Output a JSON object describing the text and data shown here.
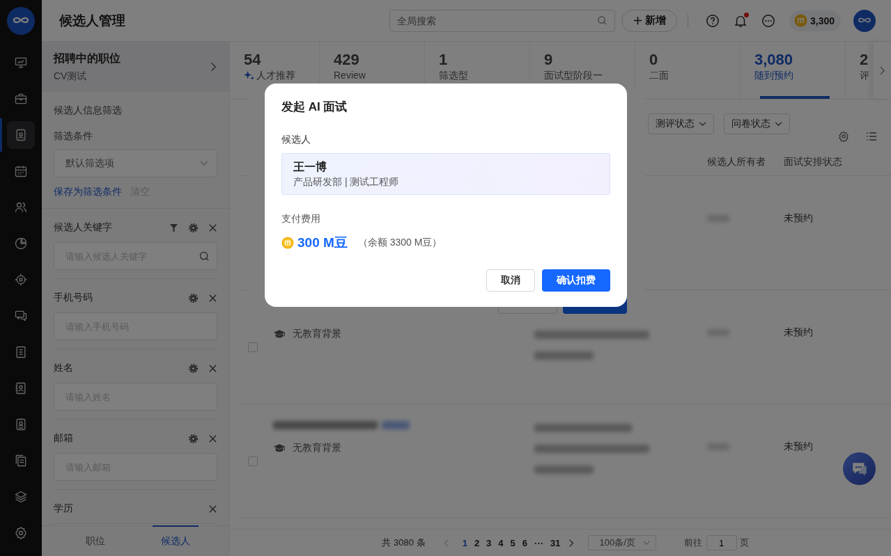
{
  "nav_rail": {
    "items": [
      {
        "selected": false
      },
      {
        "selected": false
      },
      {
        "selected": true
      },
      {
        "selected": false
      },
      {
        "selected": false
      },
      {
        "selected": false
      },
      {
        "selected": false
      },
      {
        "selected": false
      },
      {
        "selected": false
      },
      {
        "selected": false
      },
      {
        "selected": false
      },
      {
        "selected": false
      },
      {
        "selected": false
      },
      {
        "selected": false
      }
    ]
  },
  "header": {
    "title": "候选人管理",
    "search": {
      "placeholder": "全局搜索"
    },
    "add_button": "新增",
    "unread_notifications": true,
    "coins": "3,300"
  },
  "position_card": {
    "title": "招聘中的职位",
    "subtitle": "CV测试"
  },
  "filter": {
    "heading": "候选人信息筛选",
    "conditions_label": "筛选条件",
    "select_value": "默认筛选项",
    "save_link": "保存为筛选条件",
    "clear_link": "清空"
  },
  "fields": [
    {
      "label": "候选人关键字",
      "placeholder": "请输入候选人关键字",
      "filter_icon": true,
      "settings_icon": true,
      "search_icon": true
    },
    {
      "label": "手机号码",
      "placeholder": "请输入手机号码",
      "filter_icon": false,
      "settings_icon": true,
      "search_icon": false
    },
    {
      "label": "姓名",
      "placeholder": "请输入姓名",
      "filter_icon": false,
      "settings_icon": true,
      "search_icon": false
    },
    {
      "label": "邮箱",
      "placeholder": "请输入邮箱",
      "filter_icon": false,
      "settings_icon": true,
      "search_icon": false
    },
    {
      "label": "学历",
      "filter_icon": false,
      "settings_icon": false,
      "search_icon": false
    }
  ],
  "panel_tabs": [
    {
      "label": "职位",
      "selected": false
    },
    {
      "label": "候选人",
      "selected": true
    }
  ],
  "stage_tabs": [
    {
      "count": "54",
      "label": "人才推荐",
      "kind": "ai",
      "selected": false
    },
    {
      "count": "429",
      "label": "Review",
      "kind": "plain",
      "selected": false
    },
    {
      "count": "1",
      "label": "筛选型",
      "kind": "plain",
      "selected": false
    },
    {
      "count": "9",
      "label": "面试型阶段一",
      "kind": "plain",
      "selected": false
    },
    {
      "count": "0",
      "label": "二面",
      "kind": "plain",
      "selected": false
    },
    {
      "count": "3,080",
      "label": "随到预约",
      "kind": "plain",
      "selected": true
    },
    {
      "count": "2",
      "label": "评",
      "kind": "plain",
      "selected": false
    }
  ],
  "table_filters": [
    "测评状态",
    "问卷状态"
  ],
  "table": {
    "columns": [
      "候选人所有者",
      "面试安排状态"
    ],
    "rows": [
      {
        "status": "未预约"
      },
      {
        "education": "无教育背景",
        "status": "未预约",
        "checked": false
      },
      {
        "education": "无教育背景",
        "status": "未预约",
        "checked": false
      }
    ]
  },
  "pagination": {
    "total": "共 3080 条",
    "pages": [
      {
        "label": "1",
        "selected": true
      },
      {
        "label": "2",
        "selected": false
      },
      {
        "label": "3",
        "selected": false
      },
      {
        "label": "4",
        "selected": false
      },
      {
        "label": "5",
        "selected": false
      },
      {
        "label": "6",
        "selected": false
      },
      {
        "label": "···",
        "selected": false
      },
      {
        "label": "31",
        "selected": false
      }
    ],
    "page_size": "100条/页",
    "goto_label": "前往",
    "goto_value": "1",
    "goto_suffix": "页"
  },
  "dialog": {
    "title": "发起 AI 面试",
    "candidate_label": "候选人",
    "candidate": {
      "name": "王一博",
      "detail": "产品研发部 | 测试工程师"
    },
    "fee_label": "支付费用",
    "fee": "300 M豆",
    "balance": "（余额 3300 M豆）",
    "cancel_button": "取消",
    "confirm_button": "确认扣费"
  }
}
